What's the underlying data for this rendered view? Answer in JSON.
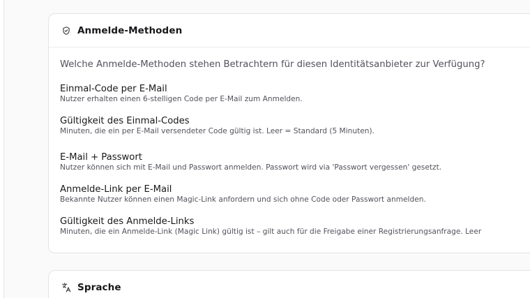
{
  "login_methods": {
    "title": "Anmelde-Methoden",
    "icon": "shield-check-icon",
    "question": "Welche Anmelde-Methoden stehen Betrachtern für diesen Identitätsanbieter zur Verfügung?",
    "options": [
      {
        "title": "Einmal-Code per E-Mail",
        "description": "Nutzer erhalten einen 6-stelligen Code per E-Mail zum Anmelden."
      },
      {
        "title": "Gültigkeit des Einmal-Codes",
        "description": "Minuten, die ein per E-Mail versendeter Code gültig ist. Leer = Standard (5 Minuten)."
      },
      {
        "title": "E-Mail + Passwort",
        "description": "Nutzer können sich mit E-Mail und Passwort anmelden. Passwort wird via 'Passwort vergessen' gesetzt."
      },
      {
        "title": "Anmelde-Link per E-Mail",
        "description": "Bekannte Nutzer können einen Magic-Link anfordern und sich ohne Code oder Passwort anmelden."
      },
      {
        "title": "Gültigkeit des Anmelde-Links",
        "description": "Minuten, die ein Anmelde-Link (Magic Link) gültig ist – gilt auch für die Freigabe einer Registrierungsanfrage. Leer"
      }
    ]
  },
  "language": {
    "title": "Sprache",
    "icon": "translate-icon"
  }
}
